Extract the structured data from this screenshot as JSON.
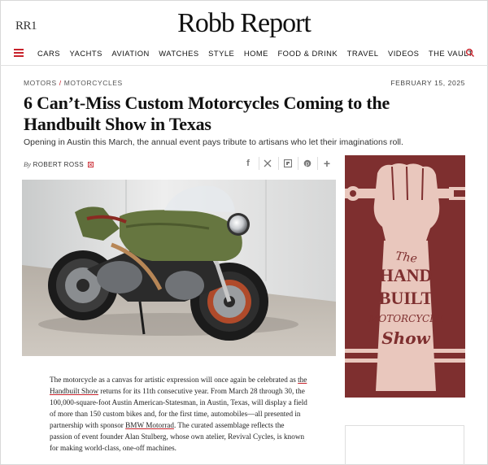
{
  "header": {
    "mark": "RR1",
    "logo": "Robb Report"
  },
  "nav": {
    "items": [
      "CARS",
      "YACHTS",
      "AVIATION",
      "WATCHES",
      "STYLE",
      "HOME",
      "FOOD & DRINK",
      "TRAVEL",
      "VIDEOS",
      "THE VAULT"
    ]
  },
  "article": {
    "breadcrumb": [
      "MOTORS",
      "MOTORCYCLES"
    ],
    "breadcrumb_sep": "/",
    "date": "FEBRUARY 15, 2025",
    "title": "6 Can’t-Miss Custom Motorcycles Coming to the Handbuilt Show in Texas",
    "dek": "Opening in Austin this March, the annual event pays tribute to artisans who let their imaginations roll.",
    "byline_prefix": "By",
    "author": "ROBERT ROSS",
    "share_icons": [
      "facebook-icon",
      "x-icon",
      "flipboard-icon",
      "pinterest-icon",
      "plus-icon"
    ],
    "share_glyphs": [
      "f",
      "𝕏",
      "",
      "℗",
      "+"
    ],
    "hero_alt": "Green custom cafe racer motorcycle",
    "body": {
      "p1_a": "The motorcycle as a canvas for artistic expression will once again be celebrated as ",
      "link1": "the Handbuilt Show",
      "p1_b": " returns for its 11th consecutive year. From March 28 through 30, the 100,000-square-foot Austin American-Statesman, in Austin, Texas, will display a field of more than 150 custom bikes and, for the first time, automobiles—all presented in partnership with sponsor ",
      "link2": "BMW Motorrad",
      "p1_c": ". The curated assemblage reflects the passion of event founder Alan Stulberg, whose own atelier, Revival Cycles, is known for making world-class, one-off machines."
    }
  },
  "ad": {
    "line1": "The",
    "line2": "HAND",
    "line3": "BUILT",
    "line4": "MOTORCYCLE",
    "line5": "Show"
  },
  "colors": {
    "accent": "#c8222b",
    "ad_bg": "#7e2f2f",
    "ad_art": "#e9c7bd"
  }
}
